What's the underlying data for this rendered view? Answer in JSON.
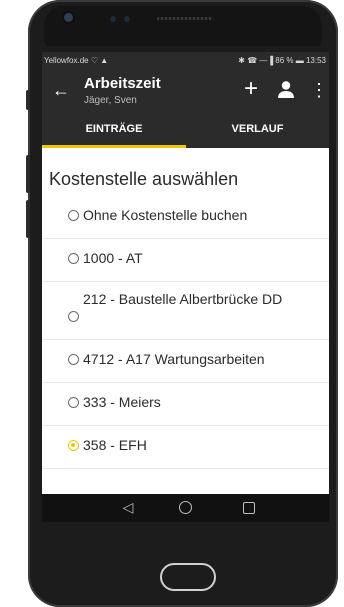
{
  "status": {
    "left": "Yellowfox.de ♡ ▲",
    "right": "✱ ☎ —▐ 86 % ▬ 13:53"
  },
  "header": {
    "title": "Arbeitszeit",
    "subtitle": "Jäger, Sven",
    "back_icon": "←",
    "add_icon": "+",
    "more_icon": "⋮"
  },
  "tabs": [
    {
      "label": "EINTRÄGE",
      "active": true
    },
    {
      "label": "VERLAUF",
      "active": false
    }
  ],
  "list_title": "Kostenstelle auswählen",
  "items": [
    {
      "label": "Ohne Kostenstelle buchen",
      "checked": false
    },
    {
      "label": "1000 - AT",
      "checked": false
    },
    {
      "label": "212 - Baustelle Albertbrücke DD",
      "checked": false
    },
    {
      "label": "4712 - A17 Wartungsarbeiten",
      "checked": false
    },
    {
      "label": "333 - Meiers",
      "checked": false
    },
    {
      "label": "358 - EFH",
      "checked": true
    }
  ],
  "nav": {
    "back": "◁"
  },
  "colors": {
    "accent": "#f5c400",
    "appbar": "#2b2b2b"
  }
}
